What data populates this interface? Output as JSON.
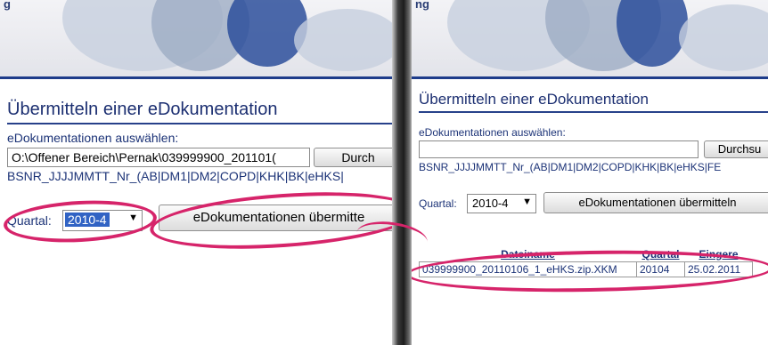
{
  "left": {
    "header_text": "g",
    "title": "Übermitteln einer eDokumentation",
    "select_label": "eDokumentationen auswählen:",
    "file_path": "O:\\Offener Bereich\\Pernak\\039999900_201101(",
    "browse_label": "Durch",
    "filename_hint": "BSNR_JJJJMMTT_Nr_(AB|DM1|DM2|COPD|KHK|BK|eHKS|",
    "quartal_label": "Quartal:",
    "quartal_value": "2010-4",
    "submit_label": "eDokumentationen übermitte"
  },
  "right": {
    "header_text": "ng",
    "title": "Übermitteln einer eDokumentation",
    "select_label": "eDokumentationen auswählen:",
    "browse_label": "Durchsu",
    "filename_hint": "BSNR_JJJJMMTT_Nr_(AB|DM1|DM2|COPD|KHK|BK|eHKS|FE",
    "quartal_label": "Quartal:",
    "quartal_value": "2010-4",
    "submit_label": "eDokumentationen übermitteln",
    "table": {
      "headers": [
        "Dateiname",
        "Quartal",
        "Eingere"
      ],
      "rows": [
        [
          "039999900_20110106_1_eHKS.zip.XKM",
          "20104",
          "25.02.2011"
        ]
      ]
    }
  },
  "colors": {
    "title": "#1c2f71",
    "highlight_ellipse": "#d6246a",
    "selection": "#3163c4"
  },
  "icons": [
    "dropdown-arrow-icon"
  ]
}
